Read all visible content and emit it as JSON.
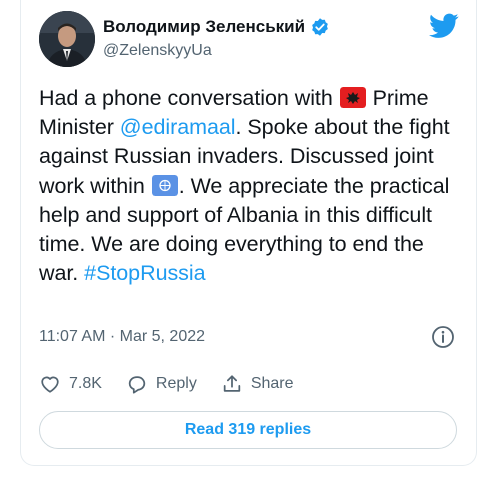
{
  "author": {
    "display_name": "Володимир Зеленський",
    "handle": "@ZelenskyyUa",
    "verified": true
  },
  "tweet": {
    "segments": {
      "t1": "Had a phone conversation with ",
      "t2": " Prime Minister ",
      "mention": "@ediramaal",
      "t3": ". Spoke about the fight against Russian invaders. Discussed joint work within ",
      "t4": ". We appreciate the practical help and support of Albania in this difficult time. We are doing everything to end the war. ",
      "hashtag": "#StopRussia"
    },
    "emojis": [
      "albania-flag",
      "united-nations-flag"
    ]
  },
  "timestamp": "11:07 AM · Mar 5, 2022",
  "actions": {
    "like_count": "7.8K",
    "reply_label": "Reply",
    "share_label": "Share"
  },
  "read_replies_label": "Read 319 replies",
  "colors": {
    "link": "#1d9bf0",
    "secondary": "#536471",
    "border": "#cfd9de",
    "albania_red": "#e41e20",
    "un_blue": "#5b92e5"
  }
}
